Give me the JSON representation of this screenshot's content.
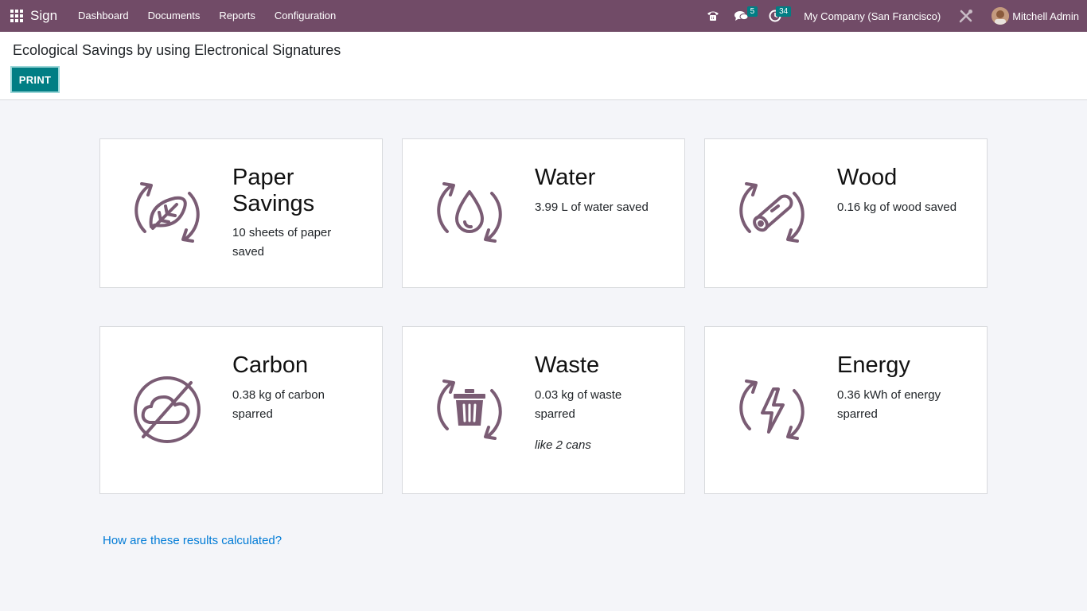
{
  "navbar": {
    "app_name": "Sign",
    "menu": [
      "Dashboard",
      "Documents",
      "Reports",
      "Configuration"
    ],
    "messages_count": "5",
    "activities_count": "34",
    "company": "My Company (San Francisco)",
    "user": "Mitchell Admin",
    "colors": {
      "brand": "#714b67",
      "accent": "#017e84"
    }
  },
  "control": {
    "title": "Ecological Savings by using Electronical Signatures",
    "print_label": "PRINT"
  },
  "cards": [
    {
      "icon": "leaf-recycle-icon",
      "title": "Paper Savings",
      "desc": "10 sheets of paper saved",
      "note": ""
    },
    {
      "icon": "water-drop-recycle-icon",
      "title": "Water",
      "desc": "3.99 L of water saved",
      "note": ""
    },
    {
      "icon": "log-recycle-icon",
      "title": "Wood",
      "desc": "0.16 kg of wood saved",
      "note": ""
    },
    {
      "icon": "no-cloud-icon",
      "title": "Carbon",
      "desc": "0.38 kg of carbon sparred",
      "note": ""
    },
    {
      "icon": "trash-recycle-icon",
      "title": "Waste",
      "desc": "0.03 kg of waste sparred",
      "note": "like 2 cans"
    },
    {
      "icon": "lightning-recycle-icon",
      "title": "Energy",
      "desc": "0.36 kWh of energy sparred",
      "note": ""
    }
  ],
  "help_link": "How are these results calculated?"
}
